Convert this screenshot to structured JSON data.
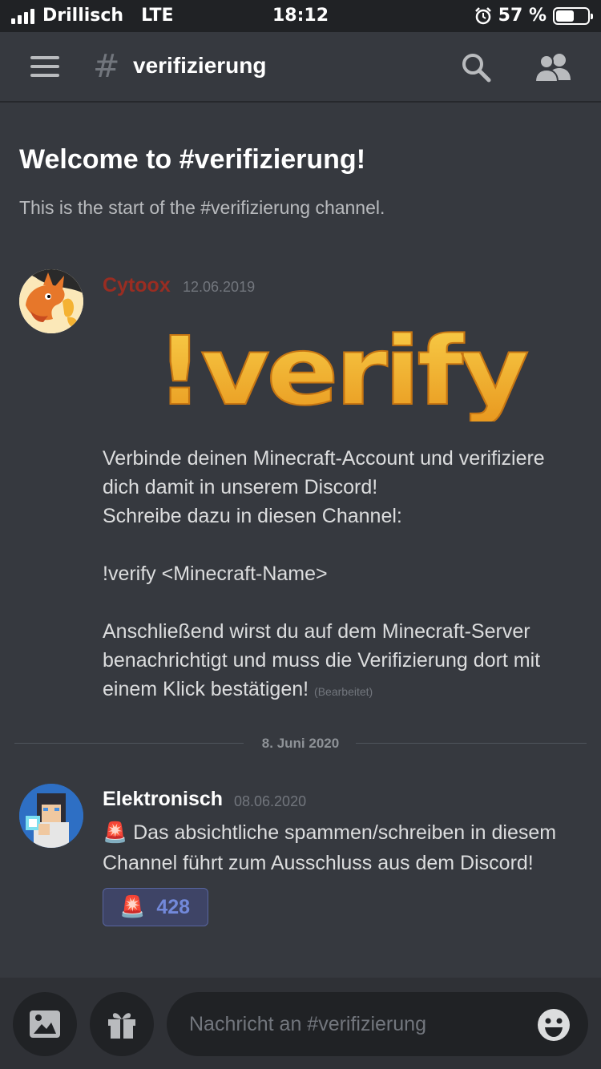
{
  "status_bar": {
    "carrier": "Drillisch",
    "network": "LTE",
    "time": "18:12",
    "battery_label": "57 %",
    "battery_level": 0.57
  },
  "header": {
    "channel_name": "verifizierung",
    "icons": [
      "menu-icon",
      "hash-icon",
      "search-icon",
      "members-icon"
    ]
  },
  "welcome": {
    "title": "Welcome to #verifizierung!",
    "subtitle": "This is the start of the #verifizierung channel."
  },
  "messages": [
    {
      "author": "Cytoox",
      "author_color": "#992d22",
      "timestamp": "12.06.2019",
      "image_text": "!verify",
      "text": "Verbinde deinen Minecraft-Account und verifiziere\ndich damit in unserem Discord!\nSchreibe dazu in diesen Channel:\n\n!verify <Minecraft-Name>\n\nAnschließend wirst du auf dem Minecraft-Server\nbenachrichtigt und muss die Verifizierung dort mit\neinem Klick bestätigen!",
      "edited_label": "(Bearbeitet)"
    },
    {
      "author": "Elektronisch",
      "author_color": "#ffffff",
      "timestamp": "08.06.2020",
      "text": "🚨 Das absichtliche spammen/schreiben in diesem\nChannel führt zum Ausschluss aus dem Discord!",
      "reaction": {
        "emoji": "🚨",
        "count": "428"
      }
    }
  ],
  "date_divider": "8. Juni 2020",
  "composer": {
    "placeholder": "Nachricht an #verifizierung"
  },
  "colors": {
    "background": "#36393f",
    "accent": "#7289da",
    "logo_yellow": "#f5b72e"
  }
}
